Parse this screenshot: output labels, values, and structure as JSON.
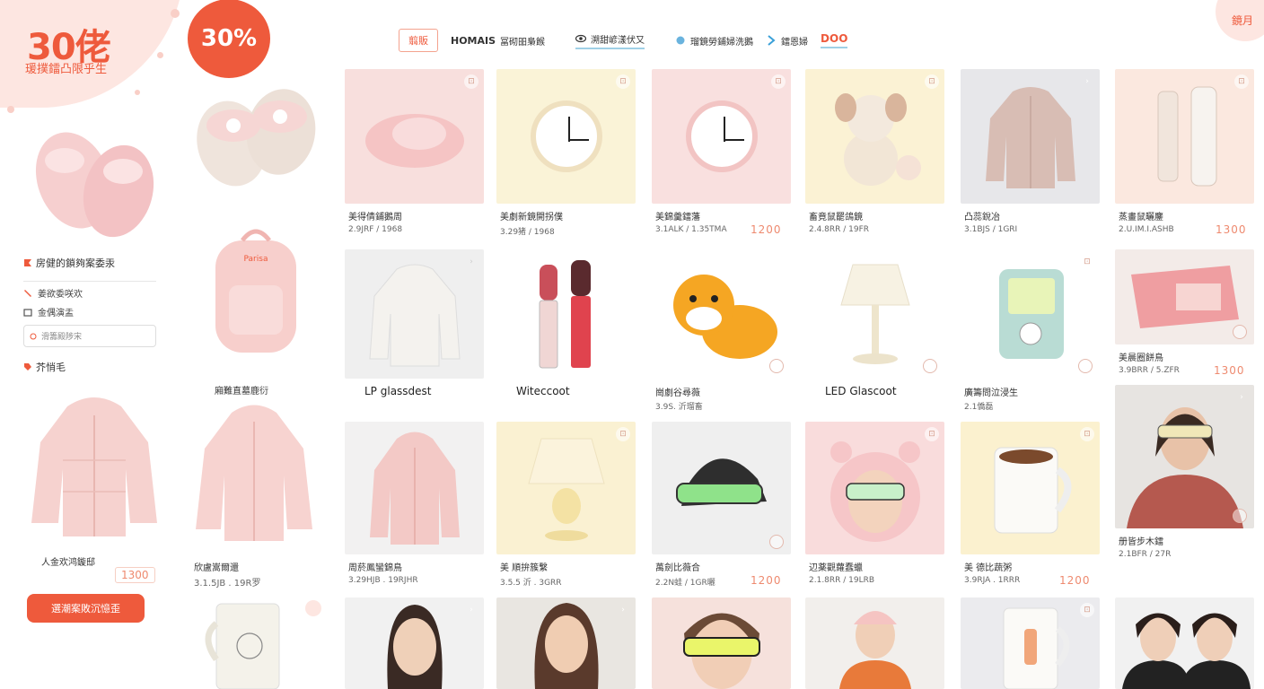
{
  "promo": {
    "headline": "30佬",
    "subline": "瑗撲鐳凸限乎生",
    "badge_top": "",
    "badge_pct": "30%",
    "badge_small": ""
  },
  "corner_button": "鏡月",
  "nav": {
    "button": "翦販",
    "items": [
      {
        "icon": "",
        "brand": "HOMAIS",
        "text": "冨砌昍梟餱"
      },
      {
        "icon": "eye-icon",
        "brand": "",
        "text": "溯甜嵃漾伏又"
      },
      {
        "icon": "dot-icon",
        "brand": "",
        "text": "瑠鏡勞鋪婦洗鵝"
      },
      {
        "icon": "arrow-icon",
        "brand": "",
        "text": "鐳恩婦"
      }
    ],
    "active": "DOO"
  },
  "sidebar": {
    "heading": "房健的鎖夠案委汞",
    "items": [
      "姜欲委咲欢",
      "金偶演盂"
    ],
    "search_placeholder": "滑籌殿陟宋",
    "section": "芥悄毛",
    "backpack_caption": "廂難直墓鹿衍",
    "jacket_caption": "人金欢鸿鏇邸",
    "jacket_price": "1300",
    "jacket2_title": "欣盧嵩爾還",
    "jacket2_meta": "3.1.5JB . 19R罗",
    "cta": "選潮案敗沉憶歪"
  },
  "rows": [
    [
      {
        "title": "美得倩鋪鵝周",
        "meta": "2.9JRF / 1968",
        "price": ""
      },
      {
        "title": "美劇新鏡開拐僕",
        "meta": "3.29猪 / 1968",
        "price": ""
      },
      {
        "title": "美錦羹鐳藩",
        "meta": "3.1ALK / 1.35TMA",
        "price": "1200"
      },
      {
        "title": "畜竟鼠罷鴿鏡",
        "meta": "2.4.8RR / 19FR",
        "price": ""
      },
      {
        "title": "凸蕊銳冶",
        "meta": "3.1BJS / 1GRI",
        "price": ""
      },
      {
        "title": "蒸畫鼠曬鏖",
        "meta": "2.U.IM.I.ASHB",
        "price": "1300"
      }
    ],
    [
      {
        "title": "LP glassdest",
        "meta": "",
        "price": ""
      },
      {
        "title": "Witeccoot",
        "meta": "",
        "price": ""
      },
      {
        "title": "崗劇谷尋薇",
        "meta": "3.9S. 沂瑠畜",
        "price": ""
      },
      {
        "title": "LED Glascoot",
        "meta": "",
        "price": ""
      },
      {
        "title": "廣籌問泣浸生",
        "meta": "2.1僑磊",
        "price": ""
      },
      {
        "title": "美晨圈餅鳥",
        "meta": "3.9BRR / 5.ZFR",
        "price": "1300"
      }
    ],
    [
      {
        "title": "周菸鳳蠻錦鳥",
        "meta": "3.29HJB . 19RJHR",
        "price": ""
      },
      {
        "title": "美 順拚簇繫",
        "meta": "3.5.5 沂 . 3GRR",
        "price": ""
      },
      {
        "title": "萬劍比薇合",
        "meta": "2.2N蛙 / 1GR曬",
        "price": "1200"
      },
      {
        "title": "辺薬觀蘿蠢蠟",
        "meta": "2.1.8RR / 19LRB",
        "price": ""
      },
      {
        "title": "美 德比蔬粥",
        "meta": "3.9RJA . 1RRR",
        "price": "1200"
      },
      {
        "title": "册皆步木鐳",
        "meta": "2.1BFR / 27R",
        "price": ""
      }
    ]
  ],
  "colors": {
    "accent": "#ee5a3c",
    "accent_soft": "#fde6e1",
    "price": "#ee8a6f",
    "nav_underline": "#9fd0e6"
  }
}
